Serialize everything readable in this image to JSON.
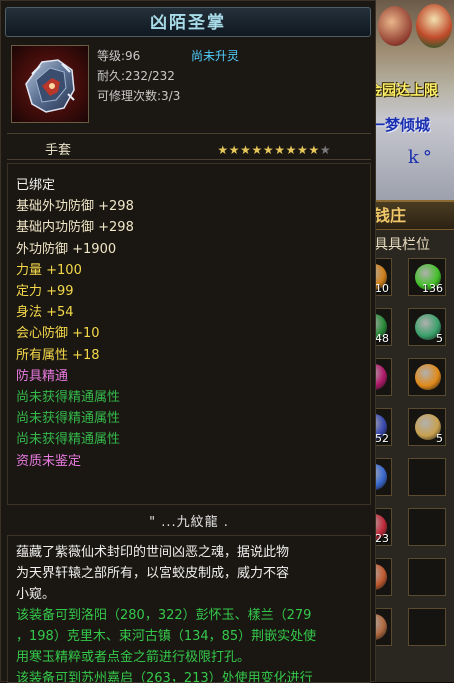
{
  "tooltip": {
    "title": "凶陌圣掌",
    "level_label": "等级:",
    "level_value": "96",
    "spirit_status": "尚未升灵",
    "durability_label": "耐久:",
    "durability_value": "232/232",
    "repair_label": "可修理次数:",
    "repair_value": "3/3",
    "item_type": "手套",
    "stars": {
      "filled": 9,
      "total": 10
    },
    "icon": "gauntlet-icon",
    "attributes": [
      {
        "text": "已绑定",
        "color": "#f0f0f0"
      },
      {
        "text": "基础外功防御 +298",
        "color": "#f0e6c8"
      },
      {
        "text": "基础内功防御 +298",
        "color": "#f0e6c8"
      },
      {
        "text": "外功防御 +1900",
        "color": "#f0e6c8"
      },
      {
        "text": "力量 +100",
        "color": "#f5d94a"
      },
      {
        "text": "定力 +99",
        "color": "#f5d94a"
      },
      {
        "text": "身法 +54",
        "color": "#f5d94a"
      },
      {
        "text": "会心防御 +10",
        "color": "#f5d94a"
      },
      {
        "text": "所有属性 +18",
        "color": "#f5d94a"
      },
      {
        "text": "防具精通",
        "color": "#e87adf"
      },
      {
        "text": "尚未获得精通属性",
        "color": "#34b84a"
      },
      {
        "text": "尚未获得精通属性",
        "color": "#34b84a"
      },
      {
        "text": "尚未获得精通属性",
        "color": "#34b84a"
      },
      {
        "text": "资质未鉴定",
        "color": "#e87adf"
      }
    ],
    "set_name": "\" ...九紋龍 .",
    "description": [
      {
        "text": "蕴藏了紫薇仙术封印的世间凶恶之魂，据说此物",
        "color": "#f0f0f0"
      },
      {
        "text": "为天界轩辕之部所有，以宮蛟皮制成，威力不容",
        "color": "#f0f0f0"
      },
      {
        "text": "小窥。",
        "color": "#f0f0f0"
      },
      {
        "text": "该装备可到洛阳（280，322）彭怀玉、樣兰（279",
        "color": "#34c84a"
      },
      {
        "text": "，198）克里木、束河古镇（134，85）荆嵌实处使",
        "color": "#34c84a"
      },
      {
        "text": "用寒玉精粹或者点金之箭进行极限打孔。",
        "color": "#34c84a"
      },
      {
        "text": "该装备可到苏州嘉启（263，213）处使用变化进行",
        "color": "#34c84a"
      }
    ]
  },
  "background": {
    "flag_text": "金园达上限",
    "player_name": "一梦倾城",
    "player_tag": "k°",
    "panel_title": "钱庄",
    "panel_subtitle": "具具栏位",
    "slots": [
      {
        "count": "10",
        "color": "#d0801a"
      },
      {
        "count": "136",
        "color": "#44c02a"
      },
      {
        "count": "48",
        "color": "#2a8a3a"
      },
      {
        "count": "5",
        "color": "#3aa06a"
      },
      {
        "count": "",
        "color": "#b01a6a"
      },
      {
        "count": "",
        "color": "#e08a1a"
      },
      {
        "count": "52",
        "color": "#3a4ab0"
      },
      {
        "count": "5",
        "color": "#c8a050"
      },
      {
        "count": "",
        "color": "#3a6ad0"
      },
      {
        "count": "",
        "color": ""
      },
      {
        "count": "23",
        "color": "#c02a3a"
      },
      {
        "count": "",
        "color": ""
      },
      {
        "count": "",
        "color": "#c05a30"
      },
      {
        "count": "",
        "color": ""
      },
      {
        "count": "",
        "color": "#b06a40"
      },
      {
        "count": "",
        "color": ""
      }
    ]
  }
}
